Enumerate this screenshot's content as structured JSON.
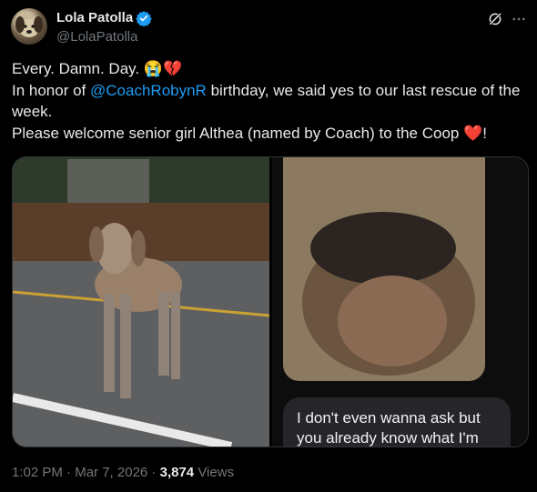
{
  "author": {
    "name": "Lola Patolla",
    "handle": "@LolaPatolla",
    "verified": true
  },
  "tweet": {
    "line1": "Every. Damn. Day. 😭💔",
    "line2_prefix": "In honor of ",
    "line2_mention": "@CoachRobynR",
    "line2_suffix": " birthday, we said yes to our last rescue of the week.",
    "line3": "Please welcome senior girl Althea (named by Coach) to the Coop ❤️!"
  },
  "media": {
    "chat_text": "I don't even wanna ask but\nyou already know what I'm"
  },
  "meta": {
    "time": "1:02 PM",
    "separator": " · ",
    "date": "Mar 7, 2026",
    "separator2": " · ",
    "views_count": "3,874",
    "views_label": " Views"
  },
  "colors": {
    "accent": "#1d9bf0",
    "background": "#000000",
    "text": "#e7e9ea",
    "muted": "#71767b"
  }
}
